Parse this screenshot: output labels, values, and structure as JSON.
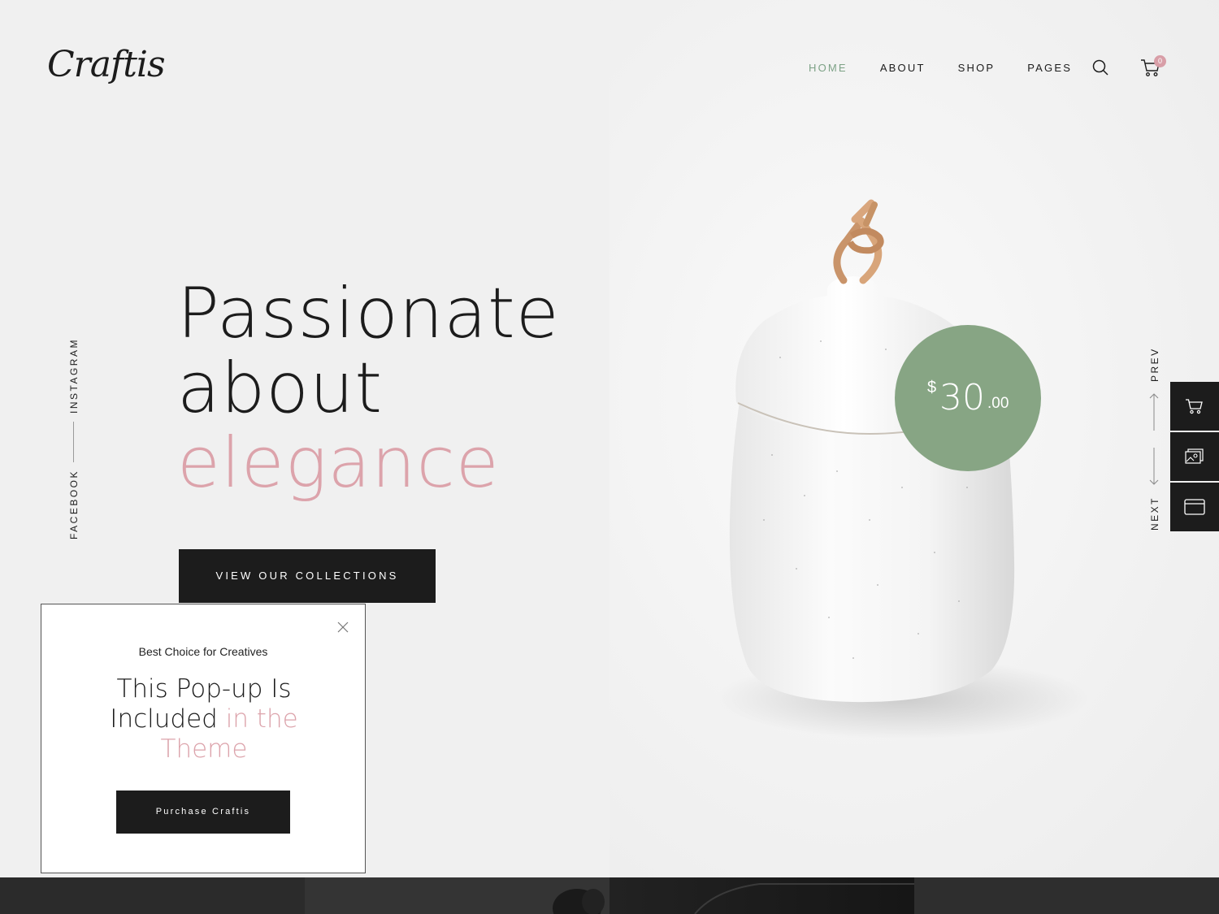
{
  "logo": {
    "text": "Craftis"
  },
  "nav": {
    "items": [
      {
        "label": "HOME",
        "active": true
      },
      {
        "label": "ABOUT"
      },
      {
        "label": "SHOP"
      },
      {
        "label": "PAGES"
      }
    ],
    "cart_count": "0"
  },
  "hero": {
    "line1": "Passionate",
    "line2": "about",
    "line3": "elegance",
    "cta_label": "VIEW OUR COLLECTIONS"
  },
  "social": {
    "instagram": "INSTAGRAM",
    "facebook": "FACEBOOK"
  },
  "popup": {
    "subtitle": "Best Choice for Creatives",
    "heading_a": "This Pop-up Is Included",
    "heading_b": "in the Theme",
    "button_label": "Purchase Craftis"
  },
  "product": {
    "price_currency": "$",
    "price_main": "30",
    "price_cents": ".00"
  },
  "pager": {
    "prev": "PREV",
    "next": "NEXT"
  },
  "colors": {
    "accent_pink": "#dca3ab",
    "accent_green": "#87a584",
    "nav_active": "#7da286",
    "dark": "#1c1c1c"
  },
  "icons": {
    "dock": [
      "cart-icon",
      "gallery-icon",
      "browser-window-icon"
    ]
  }
}
